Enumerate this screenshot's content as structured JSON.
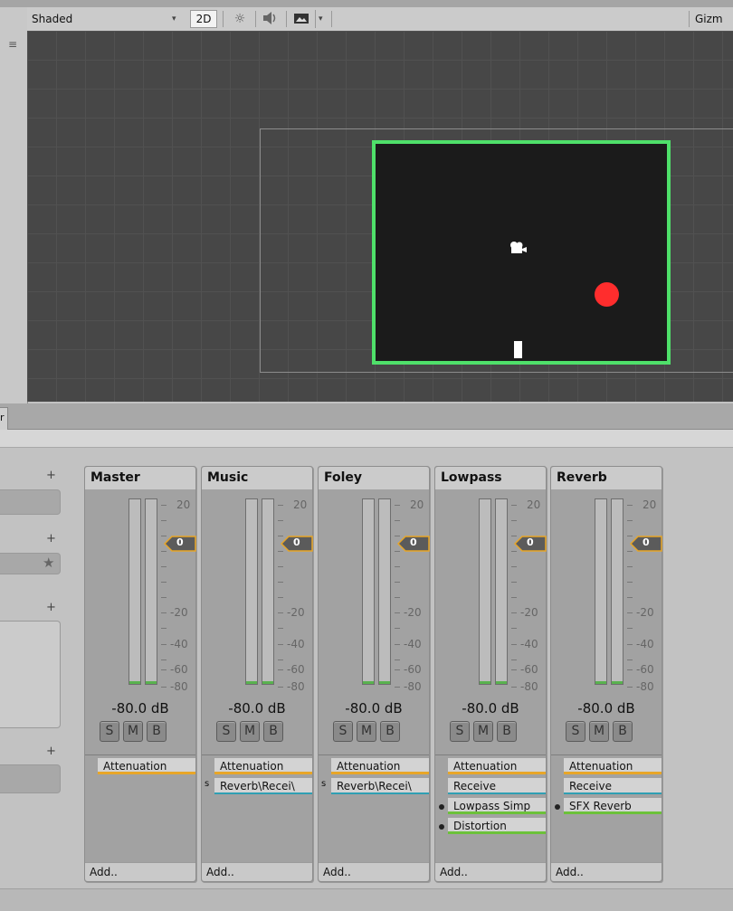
{
  "scene_toolbar": {
    "shade_mode": "Shaded",
    "mode_2d": "2D",
    "gizmos": "Gizm"
  },
  "sidebar": {
    "plus": "+",
    "star": "★"
  },
  "meter_scale": [
    "20",
    "0",
    "-20",
    "-40",
    "-60",
    "-80"
  ],
  "tab_stub": "r",
  "channels": [
    {
      "name": "Master",
      "fader": "0",
      "db": "-80.0 dB",
      "buttons": [
        "S",
        "M",
        "B"
      ],
      "effects": [
        {
          "label": "Attenuation",
          "color": "orange"
        }
      ],
      "add": "Add.."
    },
    {
      "name": "Music",
      "fader": "0",
      "db": "-80.0 dB",
      "buttons": [
        "S",
        "M",
        "B"
      ],
      "effects": [
        {
          "label": "Attenuation",
          "color": "orange"
        },
        {
          "label": "Reverb\\Recei\\",
          "color": "teal",
          "flag": "s"
        }
      ],
      "add": "Add.."
    },
    {
      "name": "Foley",
      "fader": "0",
      "db": "-80.0 dB",
      "buttons": [
        "S",
        "M",
        "B"
      ],
      "effects": [
        {
          "label": "Attenuation",
          "color": "orange"
        },
        {
          "label": "Reverb\\Recei\\",
          "color": "teal",
          "flag": "s"
        }
      ],
      "add": "Add.."
    },
    {
      "name": "Lowpass",
      "fader": "0",
      "db": "-80.0 dB",
      "buttons": [
        "S",
        "M",
        "B"
      ],
      "effects": [
        {
          "label": "Attenuation",
          "color": "orange"
        },
        {
          "label": "Receive",
          "color": "teal"
        },
        {
          "label": "Lowpass Simp",
          "color": "green",
          "dot": true
        },
        {
          "label": "Distortion",
          "color": "green",
          "dot": true
        }
      ],
      "add": "Add.."
    },
    {
      "name": "Reverb",
      "fader": "0",
      "db": "-80.0 dB",
      "buttons": [
        "S",
        "M",
        "B"
      ],
      "effects": [
        {
          "label": "Attenuation",
          "color": "orange"
        },
        {
          "label": "Receive",
          "color": "teal"
        },
        {
          "label": "SFX Reverb",
          "color": "green",
          "dot": true
        }
      ],
      "add": "Add.."
    }
  ]
}
